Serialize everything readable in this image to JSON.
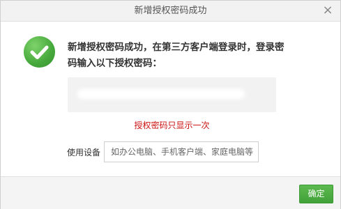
{
  "dialog": {
    "title": "新增授权密码成功",
    "close_glyph": "×",
    "message": "新增授权密码成功，在第三方客户端登录时，登录密码输入以下授权密码：",
    "note": "授权密码只显示一次",
    "device": {
      "label": "使用设备",
      "placeholder": "如办公电脑、手机客户端、家庭电脑等",
      "value": ""
    },
    "ok_label": "确定",
    "colors": {
      "accent": "#4caf43",
      "note": "#cc1111"
    },
    "icons": {
      "success": "check-circle-icon",
      "close": "close-icon"
    }
  }
}
